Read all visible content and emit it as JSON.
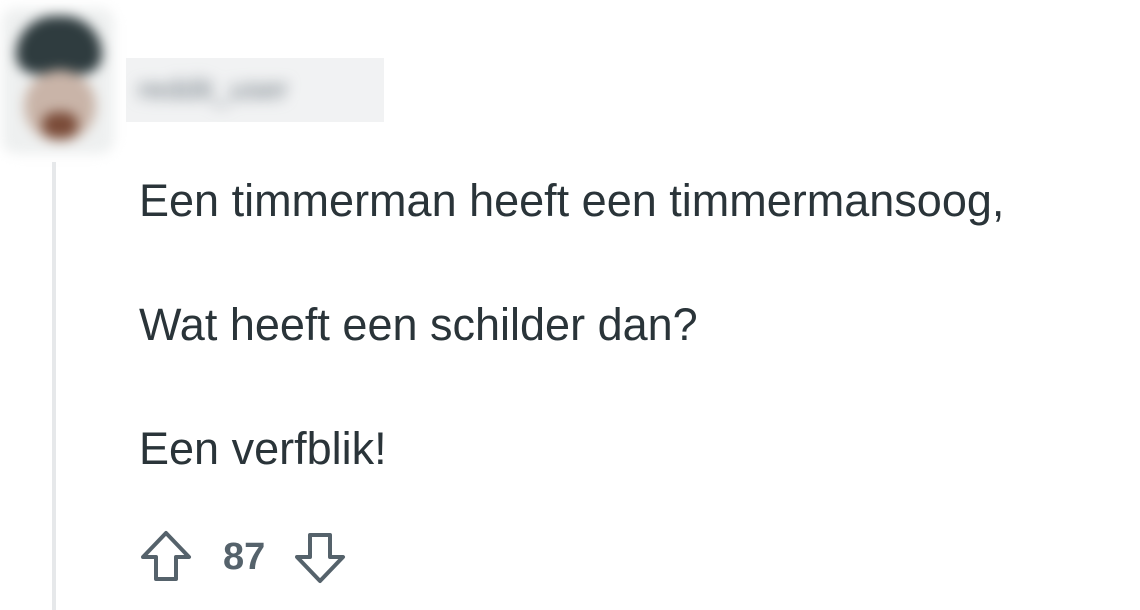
{
  "comment": {
    "author": "reddit_user",
    "paragraphs": [
      "Een timmerman heeft een timmermansoog,",
      "Wat heeft een schilder dan?",
      "Een verfblik!"
    ],
    "score": "87",
    "icons": {
      "upvote": "arrow-up-icon",
      "downvote": "arrow-down-icon"
    }
  },
  "colors": {
    "text": "#2a3439",
    "meta_text": "#55626b",
    "thread_line": "#e6e8ea",
    "background": "#ffffff"
  }
}
